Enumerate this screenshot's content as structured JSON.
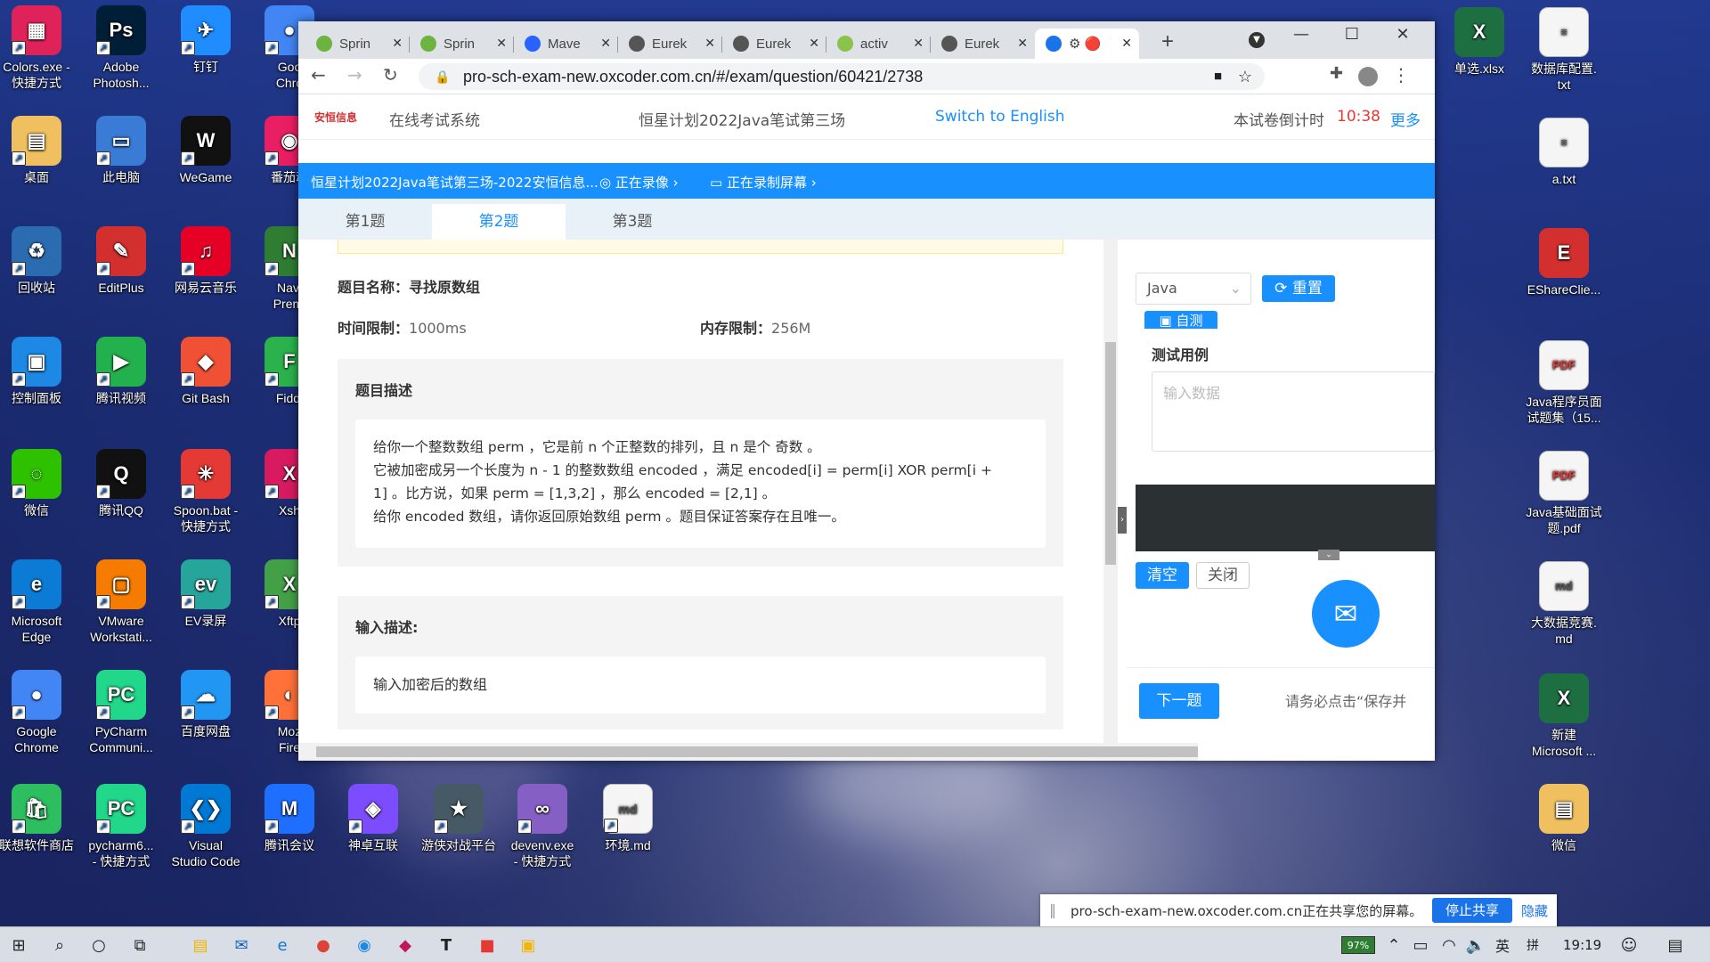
{
  "desktop": {
    "left_icons": [
      {
        "label": "Colors.exe -\n快捷方式",
        "color": "#e0225a",
        "glyph": "▦"
      },
      {
        "label": "Adobe\nPhotosh...",
        "color": "#001e36",
        "glyph": "Ps"
      },
      {
        "label": "钉钉",
        "color": "#1f8cff",
        "glyph": "✈"
      },
      {
        "label": "Goo\nChro",
        "color": "#4285f4",
        "glyph": "●"
      },
      {
        "label": "桌面",
        "color": "#f0c060",
        "glyph": "▤"
      },
      {
        "label": "此电脑",
        "color": "#3a7bd5",
        "glyph": "▭"
      },
      {
        "label": "WeGame",
        "color": "#111",
        "glyph": "W"
      },
      {
        "label": "番茄动",
        "color": "#e91e63",
        "glyph": "◉"
      },
      {
        "label": "回收站",
        "color": "#2b6cb0",
        "glyph": "♻"
      },
      {
        "label": "EditPlus",
        "color": "#d32f2f",
        "glyph": "✎"
      },
      {
        "label": "网易云音乐",
        "color": "#e60026",
        "glyph": "♫"
      },
      {
        "label": "Navi\nPremi",
        "color": "#2e7d32",
        "glyph": "N"
      },
      {
        "label": "控制面板",
        "color": "#1e88e5",
        "glyph": "▣"
      },
      {
        "label": "腾讯视频",
        "color": "#23b14d",
        "glyph": "▶"
      },
      {
        "label": "Git Bash",
        "color": "#f05033",
        "glyph": "◆"
      },
      {
        "label": "Fiddl",
        "color": "#2bb24c",
        "glyph": "F"
      },
      {
        "label": "微信",
        "color": "#2dc100",
        "glyph": "◌"
      },
      {
        "label": "腾讯QQ",
        "color": "#111",
        "glyph": "Q"
      },
      {
        "label": "Spoon.bat -\n快捷方式",
        "color": "#e53935",
        "glyph": "✳"
      },
      {
        "label": "Xsh",
        "color": "#d81b60",
        "glyph": "X"
      },
      {
        "label": "Microsoft\nEdge",
        "color": "#0c7bd6",
        "glyph": "e"
      },
      {
        "label": "VMware\nWorkstati...",
        "color": "#f57c00",
        "glyph": "▢"
      },
      {
        "label": "EV录屏",
        "color": "#26a69a",
        "glyph": "ev"
      },
      {
        "label": "Xftp",
        "color": "#43a047",
        "glyph": "X"
      },
      {
        "label": "Google\nChrome",
        "color": "#4285f4",
        "glyph": "●"
      },
      {
        "label": "PyCharm\nCommuni...",
        "color": "#21d789",
        "glyph": "PC"
      },
      {
        "label": "百度网盘",
        "color": "#2196f3",
        "glyph": "☁"
      },
      {
        "label": "Moz\nFire",
        "color": "#ff7139",
        "glyph": "◐"
      },
      {
        "label": "联想软件商店",
        "color": "#2dbe60",
        "glyph": "🛍"
      },
      {
        "label": "pycharm6...\n- 快捷方式",
        "color": "#21d789",
        "glyph": "PC"
      },
      {
        "label": "Visual\nStudio Code",
        "color": "#0078d4",
        "glyph": "❮❯"
      },
      {
        "label": "腾讯会议",
        "color": "#1e6fff",
        "glyph": "M"
      },
      {
        "label": "神卓互联",
        "color": "#7c4dff",
        "glyph": "◈"
      },
      {
        "label": "游侠对战平台",
        "color": "#455a64",
        "glyph": "★"
      },
      {
        "label": "devenv.exe\n- 快捷方式",
        "color": "#865fc5",
        "glyph": "∞"
      },
      {
        "label": "环境.md",
        "color": "#f5f5f5",
        "glyph": "md"
      }
    ],
    "right_icons": [
      {
        "label": "单选.xlsx",
        "color": "#1d6f42",
        "glyph": "X"
      },
      {
        "label": "数据库配置.\ntxt",
        "color": "#f5f5f5",
        "glyph": "≡"
      },
      {
        "label": "a.txt",
        "color": "#f5f5f5",
        "glyph": "≡"
      },
      {
        "label": "EShareClie...",
        "color": "#d32f2f",
        "glyph": "E"
      },
      {
        "label": "Java程序员面\n试题集（15...",
        "color": "#f5f5f5",
        "glyph": "PDF"
      },
      {
        "label": "Java基础面试\n题.pdf",
        "color": "#f5f5f5",
        "glyph": "PDF"
      },
      {
        "label": "大数据竞赛.\nmd",
        "color": "#f5f5f5",
        "glyph": "md"
      },
      {
        "label": "新建\nMicrosoft ...",
        "color": "#1d6f42",
        "glyph": "X"
      },
      {
        "label": "微信",
        "color": "#f0c060",
        "glyph": "▤"
      }
    ]
  },
  "browser": {
    "tabs": [
      {
        "label": "Sprin",
        "color": "#6db33f"
      },
      {
        "label": "Sprin",
        "color": "#6db33f"
      },
      {
        "label": "Mave",
        "color": "#2962ff"
      },
      {
        "label": "Eurek",
        "color": "#555"
      },
      {
        "label": "Eurek",
        "color": "#555"
      },
      {
        "label": "activ",
        "color": "#8bc34a"
      },
      {
        "label": "Eurek",
        "color": "#555"
      },
      {
        "label": "⚙ 🔴",
        "color": "#1a73e8"
      }
    ],
    "new_tab": "+",
    "url": "pro-sch-exam-new.oxcoder.com.cn/#/exam/question/60421/2738"
  },
  "site": {
    "logo": "安恒信息",
    "system_name": "在线考试系统",
    "exam_title": "恒星计划2022Java笔试第三场",
    "switch_lang": "Switch to English",
    "countdown_label": "本试卷倒计时",
    "countdown": "10:38",
    "more": "更多",
    "bar_title": "恒星计划2022Java笔试第三场-2022安恒信息...",
    "recording_cam": "正在录像",
    "recording_screen": "正在录制屏幕",
    "question_tabs": [
      "第1题",
      "第2题",
      "第3题"
    ]
  },
  "question": {
    "name_label": "题目名称：",
    "name": "寻找原数组",
    "time_label": "时间限制：",
    "time": "1000ms",
    "mem_label": "内存限制：",
    "mem": "256M",
    "desc_title": "题目描述",
    "desc_lines": [
      "给你一个整数数组 perm ，它是前 n 个正整数的排列，且 n 是个 奇数 。",
      "它被加密成另一个长度为 n - 1 的整数数组 encoded ，满足 encoded[i] = perm[i] XOR perm[i +",
      "1] 。比方说，如果 perm = [1,3,2] ，那么 encoded = [2,1] 。",
      "给你 encoded 数组，请你返回原始数组 perm 。题目保证答案存在且唯一。"
    ],
    "input_title": "输入描述:",
    "input_text": "输入加密后的数组"
  },
  "editor": {
    "language": "Java",
    "reset": "重置",
    "self_test": "自测",
    "test_case_title": "测试用例",
    "input_placeholder": "输入数据",
    "clear": "清空",
    "close": "关闭",
    "next": "下一题",
    "notice": "请务必点击“保存并"
  },
  "share_bar": {
    "text": "pro-sch-exam-new.oxcoder.com.cn正在共享您的屏幕。",
    "stop": "停止共享",
    "hide": "隐藏"
  },
  "taskbar": {
    "battery": "97%",
    "ime": "英",
    "ime2": "拼",
    "time": "19:19"
  }
}
